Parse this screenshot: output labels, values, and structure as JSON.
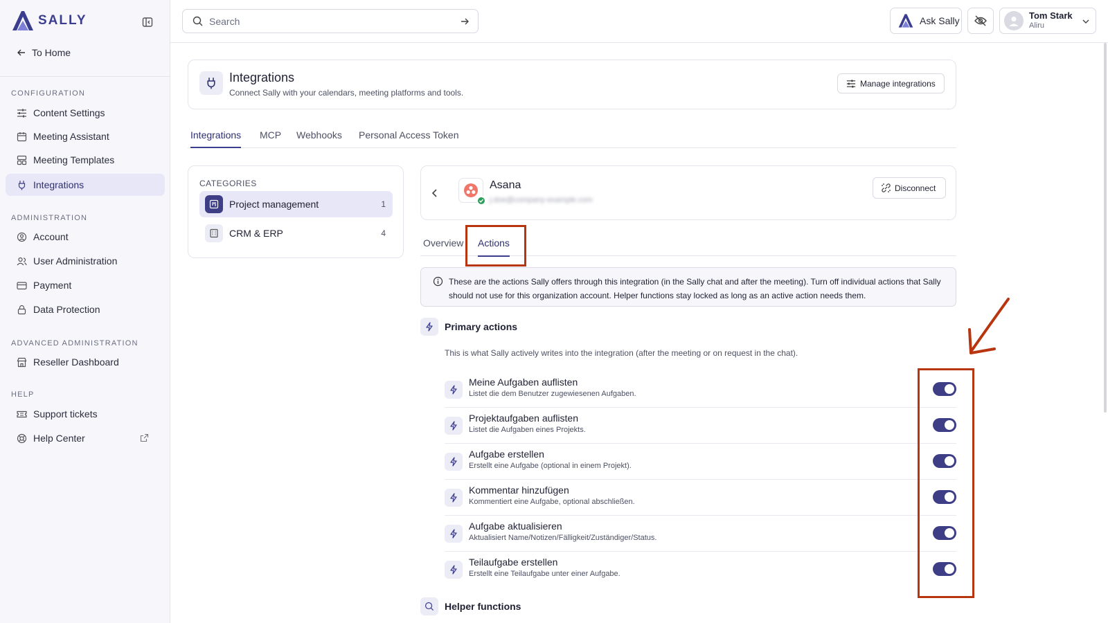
{
  "brand": {
    "name": "SALLY"
  },
  "sidebar": {
    "to_home": "To Home",
    "sections": {
      "configuration": "CONFIGURATION",
      "administration": "ADMINISTRATION",
      "advanced": "ADVANCED ADMINISTRATION",
      "help": "HELP"
    },
    "items": {
      "content_settings": "Content Settings",
      "meeting_assistant": "Meeting Assistant",
      "meeting_templates": "Meeting Templates",
      "integrations": "Integrations",
      "account": "Account",
      "user_admin": "User Administration",
      "payment": "Payment",
      "data_protection": "Data Protection",
      "reseller": "Reseller Dashboard",
      "support": "Support tickets",
      "help_center": "Help Center"
    }
  },
  "topbar": {
    "search_placeholder": "Search",
    "ask_label": "Ask Sally",
    "user_name": "Tom Stark",
    "user_org": "Aliru"
  },
  "header": {
    "title": "Integrations",
    "subtitle": "Connect Sally with your calendars, meeting platforms and tools.",
    "manage_label": "Manage integrations"
  },
  "tabs": [
    "Integrations",
    "MCP",
    "Webhooks",
    "Personal Access Token"
  ],
  "categories": {
    "title": "CATEGORIES",
    "items": [
      {
        "label": "Project management",
        "count": "1"
      },
      {
        "label": "CRM & ERP",
        "count": "4"
      }
    ]
  },
  "integration": {
    "name": "Asana",
    "email": "j.doe@company-example.com",
    "disconnect_label": "Disconnect",
    "tabs": [
      "Overview",
      "Actions"
    ]
  },
  "info_text": "These are the actions Sally offers through this integration (in the Sally chat and after the meeting). Turn off individual actions that Sally should not use for this organization account. Helper functions stay locked as long as an active action needs them.",
  "primary": {
    "title": "Primary actions",
    "subtitle": "This is what Sally actively writes into the integration (after the meeting or on request in the chat).",
    "actions": [
      {
        "title": "Meine Aufgaben auflisten",
        "desc": "Listet die dem Benutzer zugewiesenen Aufgaben."
      },
      {
        "title": "Projektaufgaben auflisten",
        "desc": "Listet die Aufgaben eines Projekts."
      },
      {
        "title": "Aufgabe erstellen",
        "desc": "Erstellt eine Aufgabe (optional in einem Projekt)."
      },
      {
        "title": "Kommentar hinzufügen",
        "desc": "Kommentiert eine Aufgabe, optional abschließen."
      },
      {
        "title": "Aufgabe aktualisieren",
        "desc": "Aktualisiert Name/Notizen/Fälligkeit/Zuständiger/Status."
      },
      {
        "title": "Teilaufgabe erstellen",
        "desc": "Erstellt eine Teilaufgabe unter einer Aufgabe."
      }
    ]
  },
  "helper": {
    "title": "Helper functions"
  },
  "colors": {
    "accent": "#3d3e85",
    "annotation": "#b8360f",
    "success": "#2e9e5a"
  }
}
